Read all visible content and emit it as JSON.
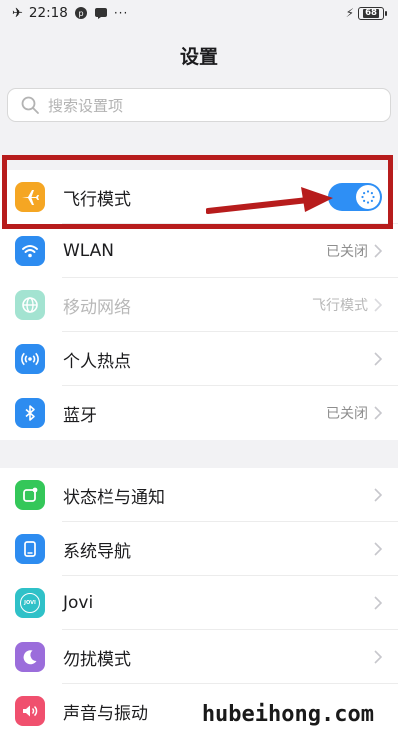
{
  "status_bar": {
    "time": "22:18",
    "more": "···",
    "battery": "68"
  },
  "header": {
    "title": "设置"
  },
  "search": {
    "placeholder": "搜索设置项"
  },
  "group1": [
    {
      "key": "airplane",
      "label": "飞行模式",
      "icon": "airplane-icon",
      "icon_color": "#f5a623",
      "toggle_on": true
    },
    {
      "key": "wlan",
      "label": "WLAN",
      "icon": "wifi-icon",
      "icon_color": "#2d8cf0",
      "status": "已关闭"
    },
    {
      "key": "mobile",
      "label": "移动网络",
      "icon": "globe-icon",
      "icon_color": "#35c39a",
      "status": "飞行模式",
      "disabled": true
    },
    {
      "key": "hotspot",
      "label": "个人热点",
      "icon": "hotspot-icon",
      "icon_color": "#2d8cf0"
    },
    {
      "key": "bluetooth",
      "label": "蓝牙",
      "icon": "bluetooth-icon",
      "icon_color": "#2d8cf0",
      "status": "已关闭"
    }
  ],
  "group2": [
    {
      "key": "statusbar",
      "label": "状态栏与通知",
      "icon": "notification-icon",
      "icon_color": "#34c759"
    },
    {
      "key": "navigation",
      "label": "系统导航",
      "icon": "navigation-icon",
      "icon_color": "#2d8cf0"
    },
    {
      "key": "jovi",
      "label": "Jovi",
      "icon": "jovi-icon",
      "icon_color": "#2fc1c8",
      "icon_text": "JOVI"
    },
    {
      "key": "dnd",
      "label": "勿扰模式",
      "icon": "moon-icon",
      "icon_color": "#9b6ddb"
    },
    {
      "key": "sound",
      "label": "声音与振动",
      "icon": "speaker-icon",
      "icon_color": "#f0506e"
    }
  ],
  "watermark": "hubeihong.com"
}
